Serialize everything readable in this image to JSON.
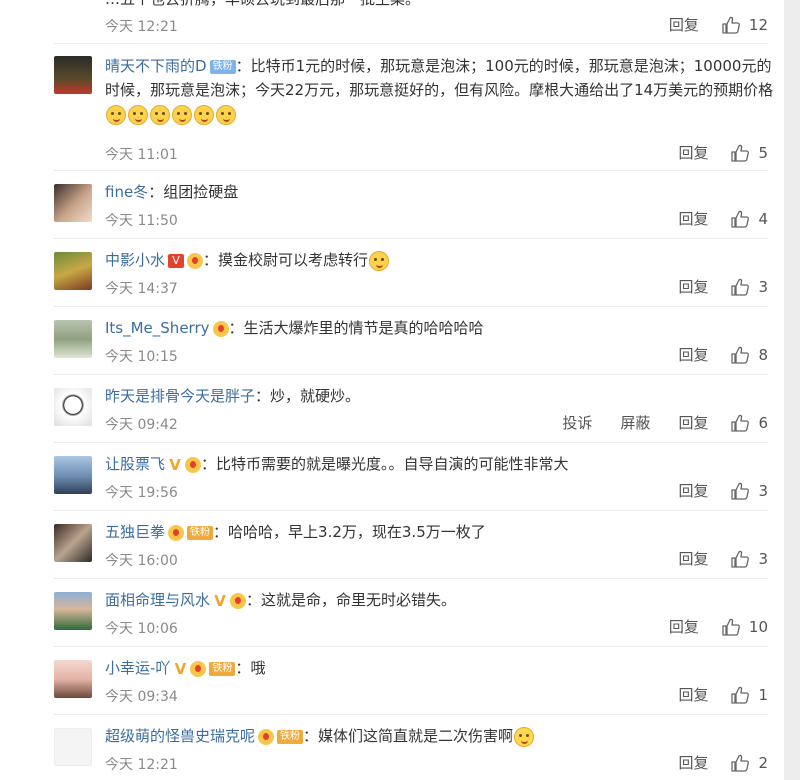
{
  "top_partial": {
    "text_clip": "…五个也去折腾，华硕去玩到最后那一批生菜。",
    "time": "今天 12:21",
    "reply": "回复",
    "likes": "12"
  },
  "comments": [
    {
      "user": "晴天不下雨的D",
      "badges": [
        "铁粉"
      ],
      "text": "比特币1元的时候，那玩意是泡沫；100元的时候，那玩意是泡沫；10000元的时候，那玩意是泡沫；今天22万元，那玩意挺好的，但有风险。摩根大通给出了14万美元的预期价格",
      "time": "今天 11:01",
      "reply": "回复",
      "likes": "5"
    },
    {
      "user": "fine冬",
      "text": "组团捡硬盘",
      "time": "今天 11:50",
      "reply": "回复",
      "likes": "4"
    },
    {
      "user": "中影小水",
      "text": "摸金校尉可以考虑转行",
      "time": "今天 14:37",
      "reply": "回复",
      "likes": "3"
    },
    {
      "user": "Its_Me_Sherry",
      "text": "生活大爆炸里的情节是真的哈哈哈哈",
      "time": "今天 10:15",
      "reply": "回复",
      "likes": "8"
    },
    {
      "user": "昨天是排骨今天是胖子",
      "text": "炒，就硬炒。",
      "time": "今天 09:42",
      "report": "投诉",
      "block": "屏蔽",
      "reply": "回复",
      "likes": "6"
    },
    {
      "user": "让股票飞",
      "text": "比特币需要的就是曝光度。。自导自演的可能性非常大",
      "time": "今天 19:56",
      "reply": "回复",
      "likes": "3"
    },
    {
      "user": "五独巨拳",
      "badges": [
        "铁粉"
      ],
      "text": "哈哈哈，早上3.2万，现在3.5万一枚了",
      "time": "今天 16:00",
      "reply": "回复",
      "likes": "3"
    },
    {
      "user": "面相命理与风水",
      "text": "这就是命，命里无时必错失。",
      "time": "今天 10:06",
      "reply": "回复",
      "likes": "10"
    },
    {
      "user": "小幸运-吖",
      "badges": [
        "铁粉"
      ],
      "text": "哦",
      "time": "今天 09:34",
      "reply": "回复",
      "likes": "1"
    },
    {
      "user": "超级萌的怪兽史瑞克呢",
      "badges": [
        "铁粉"
      ],
      "text": "媒体们这简直就是二次伤害啊",
      "time": "今天 12:21",
      "reply": "回复",
      "likes": "2"
    }
  ],
  "colors": {
    "username": "#3b6da0",
    "meta": "#8a8a8a",
    "iron_badge": "#7fb2e6"
  }
}
